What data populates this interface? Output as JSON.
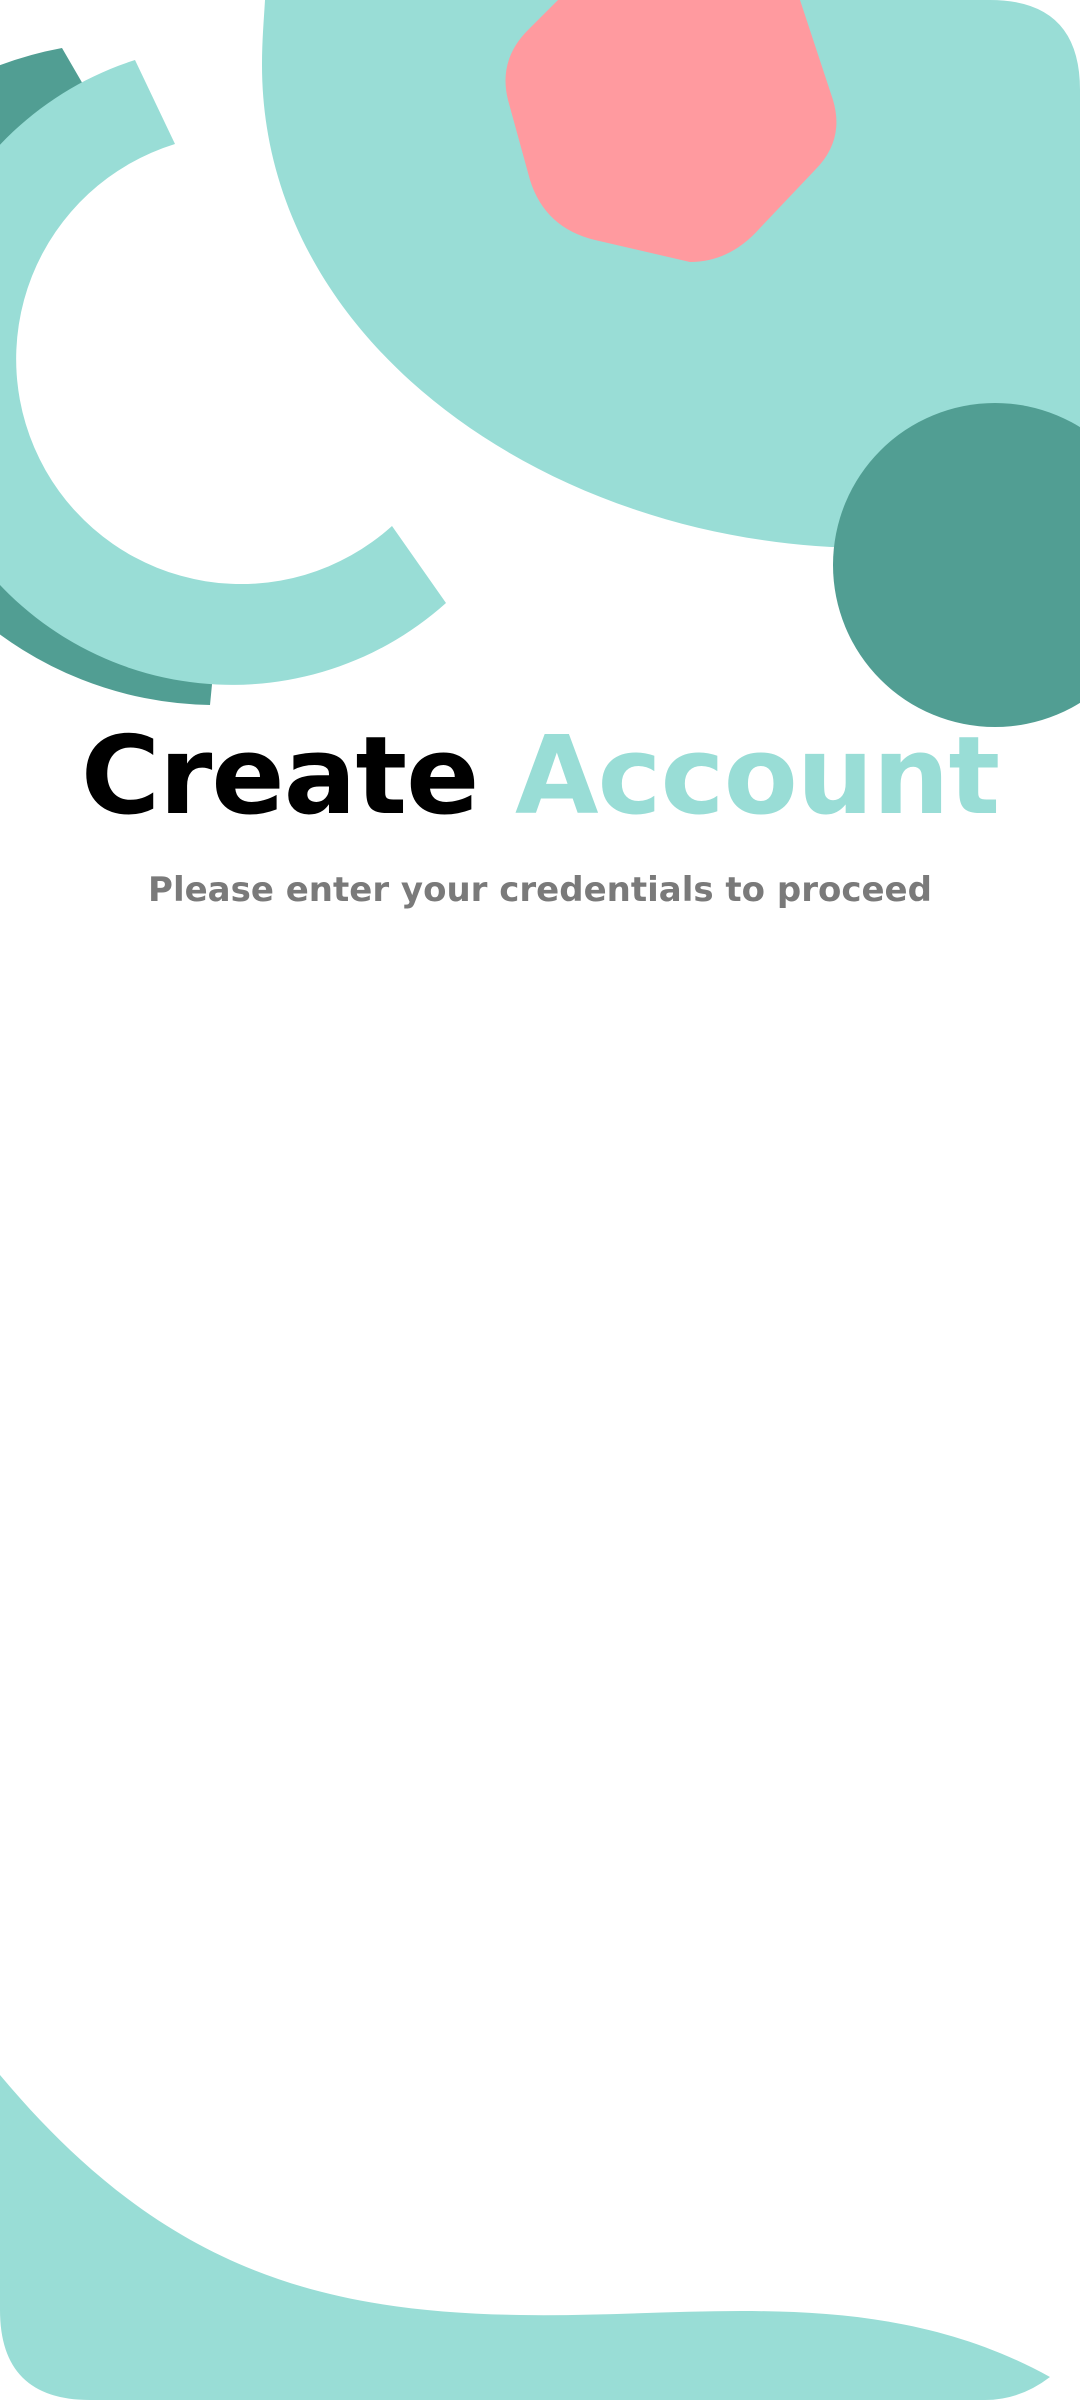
{
  "screen": {
    "title_part_1": "Create",
    "title_part_2": "Account",
    "subtitle": "Please enter your credentials to proceed"
  },
  "colors": {
    "background": "#ffffff",
    "light_teal": "#99ddd6",
    "dark_teal": "#519e93",
    "coral": "#ff9a9f",
    "title_dark": "#000000",
    "subtitle_gray": "#7a7a7a"
  }
}
